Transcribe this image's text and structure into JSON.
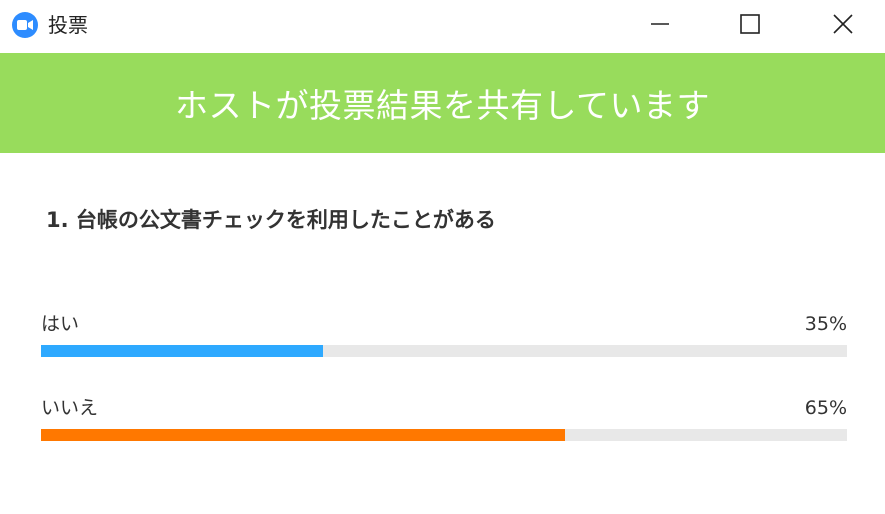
{
  "window": {
    "title": "投票"
  },
  "banner": {
    "text": "ホストが投票結果を共有しています",
    "color": "#98DC5C"
  },
  "question": {
    "text": "1. 台帳の公文書チェックを利用したことがある"
  },
  "answers": [
    {
      "label": "はい",
      "percent_text": "35%",
      "value": 35,
      "color": "#2EA9FF"
    },
    {
      "label": "いいえ",
      "percent_text": "65%",
      "value": 65,
      "color": "#FF7800"
    }
  ],
  "icons": {
    "app": "zoom-camera-icon",
    "minimize": "minimize-icon",
    "maximize": "maximize-icon",
    "close": "close-icon"
  }
}
